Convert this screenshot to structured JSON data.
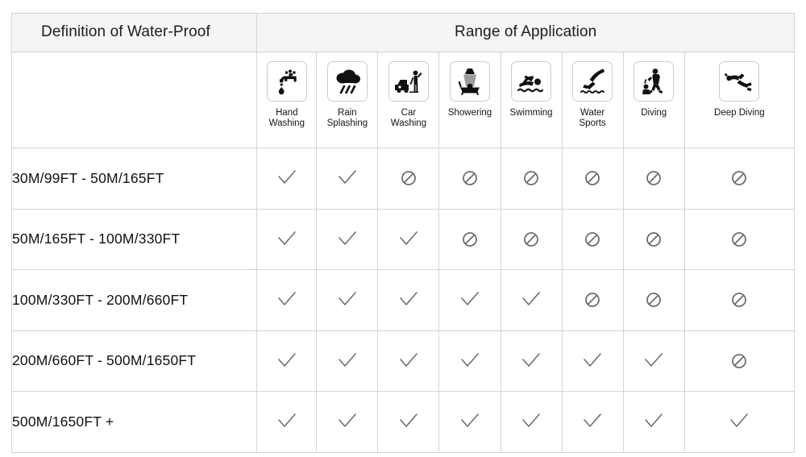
{
  "table": {
    "header": {
      "left_title": "Definition of Water-Proof",
      "right_title": "Range of Application"
    },
    "columns": [
      {
        "label": "Hand\nWashing",
        "icon": "faucet-icon"
      },
      {
        "label": "Rain\nSplashing",
        "icon": "rain-cloud-icon"
      },
      {
        "label": "Car\nWashing",
        "icon": "car-washing-icon"
      },
      {
        "label": "Showering",
        "icon": "showering-icon"
      },
      {
        "label": "Swimming",
        "icon": "swimming-icon"
      },
      {
        "label": "Water\nSports",
        "icon": "water-sports-icon"
      },
      {
        "label": "Diving",
        "icon": "diving-icon"
      },
      {
        "label": "Deep Diving",
        "icon": "deep-diving-icon"
      }
    ],
    "rows": [
      {
        "rating": "30M/99FT  -  50M/165FT",
        "marks": [
          "check",
          "check",
          "deny",
          "deny",
          "deny",
          "deny",
          "deny",
          "deny"
        ]
      },
      {
        "rating": "50M/165FT  -  100M/330FT",
        "marks": [
          "check",
          "check",
          "check",
          "deny",
          "deny",
          "deny",
          "deny",
          "deny"
        ]
      },
      {
        "rating": "100M/330FT  -  200M/660FT",
        "marks": [
          "check",
          "check",
          "check",
          "check",
          "check",
          "deny",
          "deny",
          "deny"
        ]
      },
      {
        "rating": "200M/660FT  -  500M/1650FT",
        "marks": [
          "check",
          "check",
          "check",
          "check",
          "check",
          "check",
          "check",
          "deny"
        ]
      },
      {
        "rating": "500M/1650FT  +",
        "marks": [
          "check",
          "check",
          "check",
          "check",
          "check",
          "check",
          "check",
          "check"
        ]
      }
    ],
    "marks_legend": {
      "check": "supported-check-icon",
      "deny": "not-supported-deny-icon"
    },
    "colors": {
      "header_fill": "#f5f5f5",
      "border": "#d4d4d4",
      "text": "#111111",
      "mark": "#6e6e6e"
    }
  }
}
